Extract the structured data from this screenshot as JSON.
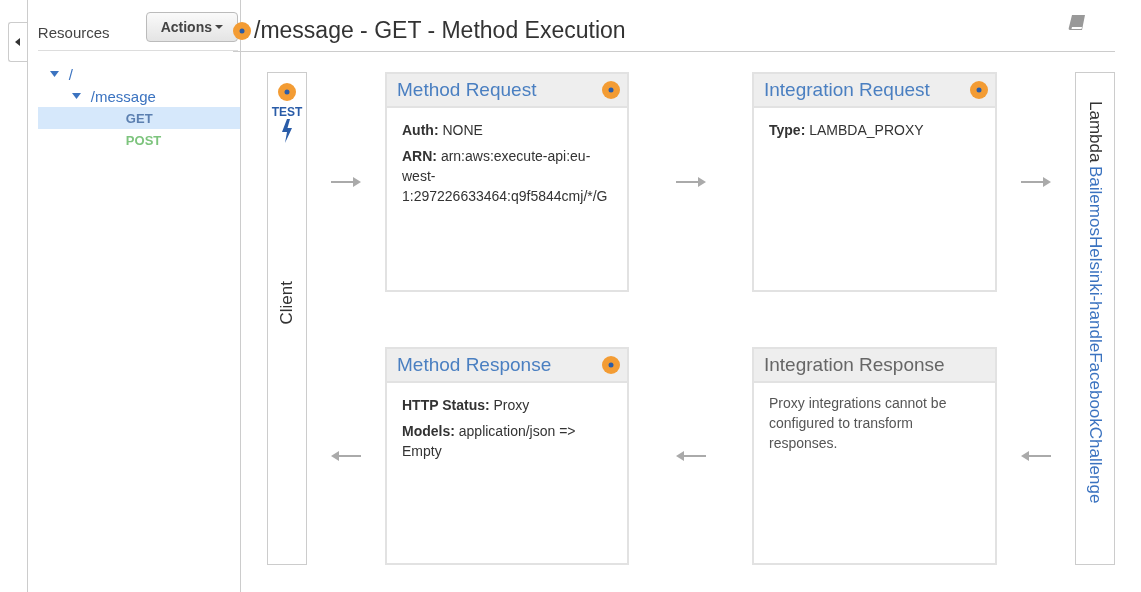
{
  "sidebar": {
    "title": "Resources",
    "actions_button": "Actions",
    "tree": [
      {
        "label": "/",
        "kind": "resource",
        "expanded": true,
        "selected": false,
        "children": [
          {
            "label": "/message",
            "kind": "resource",
            "expanded": true,
            "selected": false,
            "children": [
              {
                "label": "GET",
                "kind": "method",
                "color": "#5b7fb0",
                "selected": true
              },
              {
                "label": "POST",
                "kind": "method",
                "color": "#7dc47d",
                "selected": false
              }
            ]
          }
        ]
      }
    ]
  },
  "header": {
    "title": "/message - GET - Method Execution"
  },
  "client": {
    "test_label": "TEST",
    "label": "Client"
  },
  "cards": [
    {
      "title": "Method Request",
      "editable": true,
      "fields": [
        {
          "label": "Auth:",
          "value": "NONE"
        },
        {
          "label": "ARN:",
          "value": "arn:aws:execute-api:eu-west-1:297226633464:q9f5844cmj/*/G"
        }
      ]
    },
    {
      "title": "Integration Request",
      "editable": true,
      "fields": [
        {
          "label": "Type:",
          "value": "LAMBDA_PROXY"
        }
      ]
    },
    {
      "title": "Method Response",
      "editable": true,
      "fields": [
        {
          "label": "HTTP Status:",
          "value": "Proxy"
        },
        {
          "label": "Models:",
          "value": "application/json => Empty"
        }
      ]
    },
    {
      "title": "Integration Response",
      "editable": false,
      "note": "Proxy integrations cannot be configured to transform responses."
    }
  ],
  "backend": {
    "label": "Lambda",
    "function_name": "BailemosHelsinki-handleFacebookChallenge"
  }
}
